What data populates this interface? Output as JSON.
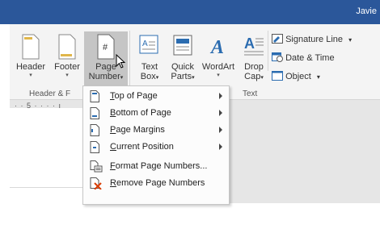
{
  "titlebar": {
    "user": "Javie",
    "color": "#2b579a"
  },
  "ribbon": {
    "header_label": "Header",
    "footer_label": "Footer",
    "page_number_label_line1": "Page",
    "page_number_label_line2": "Number",
    "page_number_icon_text": "#",
    "text_box_label_line1": "Text",
    "text_box_label_line2": "Box",
    "quick_parts_label_line1": "Quick",
    "quick_parts_label_line2": "Parts",
    "wordart_label": "WordArt",
    "drop_cap_label_line1": "Drop",
    "drop_cap_label_line2": "Cap",
    "signature_line_label": "Signature Line",
    "date_time_label": "Date & Time",
    "object_label": "Object",
    "group_header_footer": "Header & F",
    "group_text": "Text"
  },
  "ruler": {
    "marks": "· · 5 · · · · ı"
  },
  "menu": {
    "items": [
      {
        "label": "Top of Page",
        "submenu": true
      },
      {
        "label": "Bottom of Page",
        "submenu": true
      },
      {
        "label": "Page Margins",
        "submenu": true
      },
      {
        "label": "Current Position",
        "submenu": true
      },
      {
        "label": "Format Page Numbers...",
        "submenu": false
      },
      {
        "label": "Remove Page Numbers",
        "submenu": false
      }
    ]
  },
  "colors": {
    "accent": "#2b579a",
    "icon_blue": "#2b6cb0",
    "remove_red": "#d83b01"
  }
}
